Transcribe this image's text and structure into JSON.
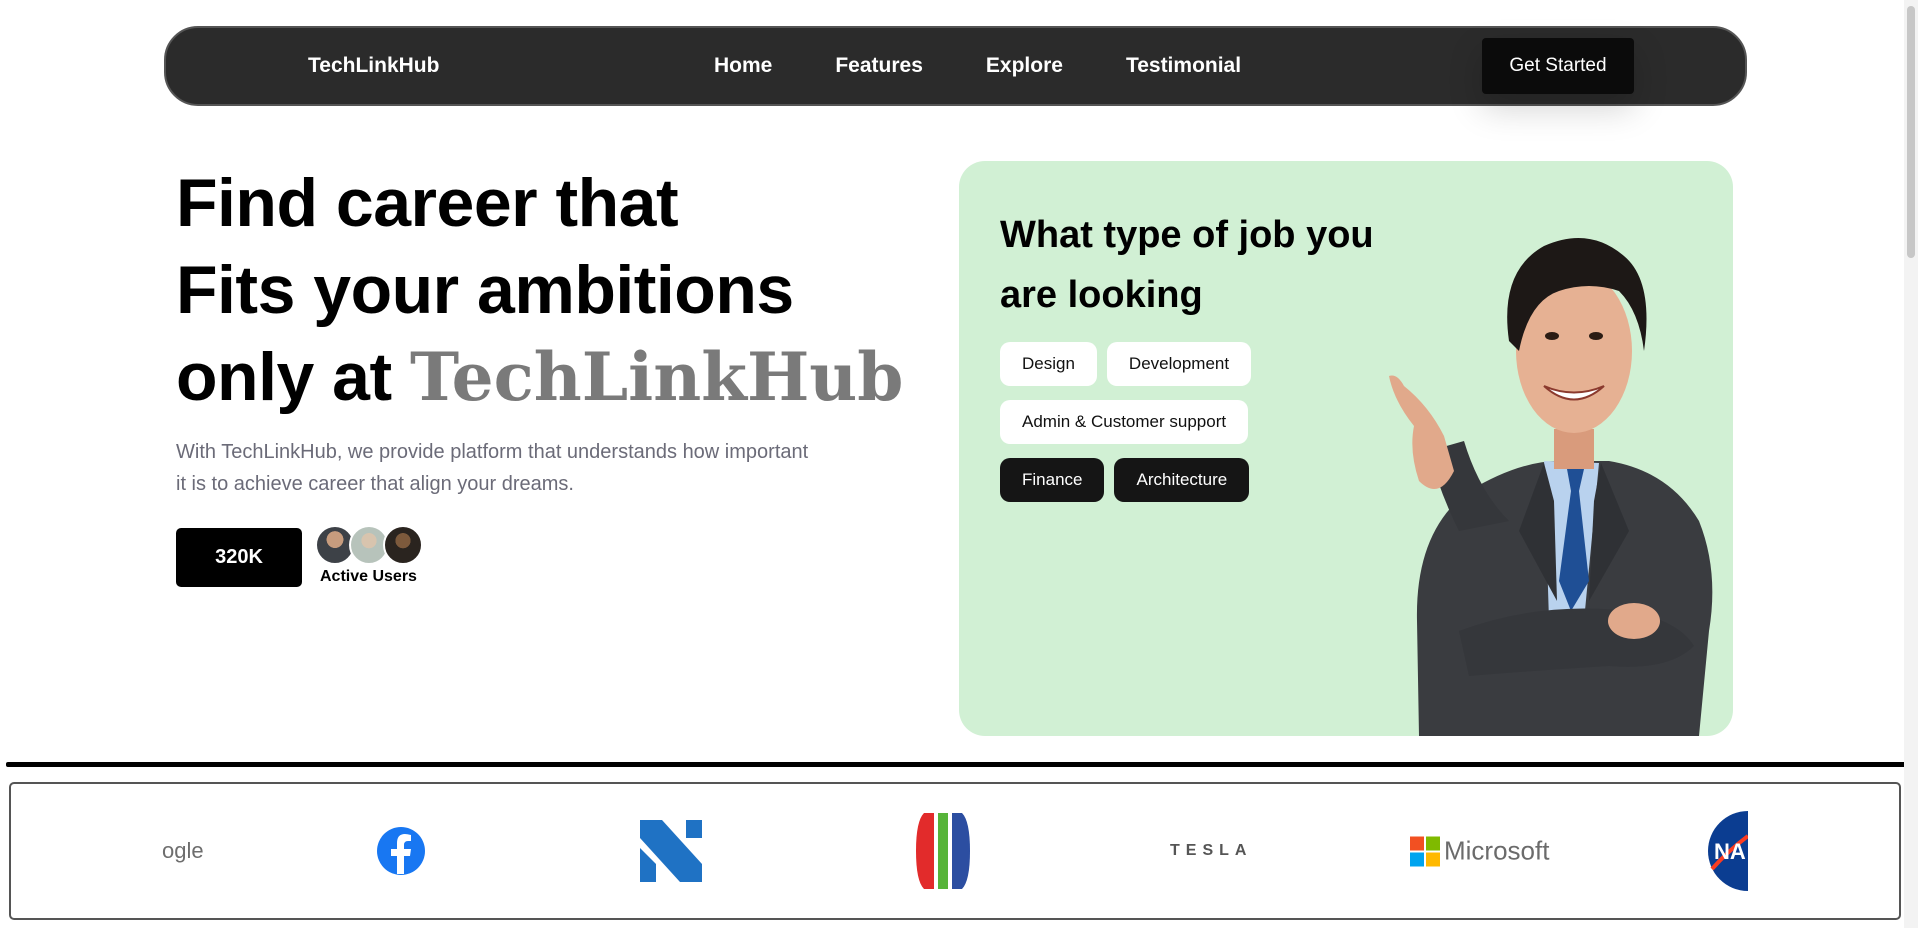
{
  "nav": {
    "brand": "TechLinkHub",
    "links": [
      "Home",
      "Features",
      "Explore",
      "Testimonial"
    ],
    "cta": "Get Started"
  },
  "hero": {
    "title_line1": "Find career that",
    "title_line2": "Fits your ambitions",
    "title_line3_prefix": "only at",
    "title_accent": "TechLinkHub",
    "description": "With TechLinkHub, we provide platform that understands how important it is to achieve career that align your dreams.",
    "stat_value": "320K",
    "stat_label": "Active Users"
  },
  "job_card": {
    "title": "What type of job you are looking",
    "categories": [
      {
        "label": "Design",
        "selected": false
      },
      {
        "label": "Development",
        "selected": false
      },
      {
        "label": "Admin & Customer support",
        "selected": false
      },
      {
        "label": "Finance",
        "selected": true
      },
      {
        "label": "Architecture",
        "selected": true
      }
    ],
    "background_color": "#d1f0d4"
  },
  "logos": {
    "google_text": "ogle",
    "tesla_text": "TESLA",
    "microsoft_text": "Microsoft",
    "nasa_text": "NA",
    "items": [
      "google-logo",
      "facebook-logo",
      "n-logo",
      "striped-bars-logo",
      "tesla-logo",
      "microsoft-logo",
      "nasa-logo"
    ]
  }
}
